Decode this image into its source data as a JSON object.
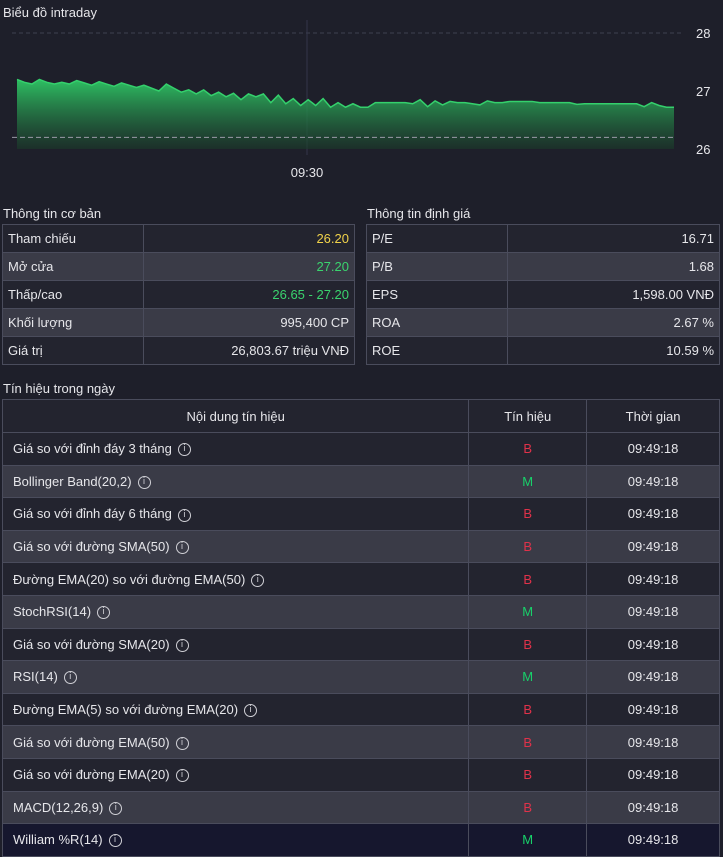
{
  "chart": {
    "title": "Biểu đồ intraday",
    "y_ticks": [
      "28",
      "27",
      "26"
    ],
    "x_tick": "09:30",
    "colors": {
      "line": "#34d06c",
      "reference_line": "#9a9aa6"
    }
  },
  "chart_data": {
    "type": "area",
    "title": "Biểu đồ intraday",
    "ylim": [
      26,
      28
    ],
    "reference": 26.2,
    "x_ticks": [
      "09:30"
    ],
    "values": [
      27.2,
      27.15,
      27.12,
      27.2,
      27.15,
      27.12,
      27.15,
      27.12,
      27.18,
      27.14,
      27.1,
      27.16,
      27.12,
      27.08,
      27.14,
      27.1,
      27.06,
      27.1,
      27.05,
      27.0,
      27.12,
      27.05,
      26.98,
      27.02,
      26.95,
      27.02,
      26.92,
      26.98,
      26.9,
      26.96,
      26.85,
      26.95,
      26.9,
      26.95,
      26.8,
      26.93,
      26.78,
      26.87,
      26.75,
      26.85,
      26.75,
      26.87,
      26.72,
      26.8,
      26.72,
      26.78,
      26.72,
      26.72,
      26.8,
      26.8,
      26.8,
      26.8,
      26.8,
      26.78,
      26.85,
      26.73,
      26.83,
      26.76,
      26.82,
      26.8,
      26.8,
      26.78,
      26.76,
      26.83,
      26.8,
      26.8,
      26.82,
      26.82,
      26.82,
      26.82,
      26.8,
      26.8,
      26.8,
      26.8,
      26.8,
      26.77,
      26.78,
      26.78,
      26.78,
      26.78,
      26.78,
      26.78,
      26.78,
      26.78,
      26.73,
      26.8,
      26.75,
      26.72,
      26.72
    ]
  },
  "basic_info": {
    "title": "Thông tin cơ bản",
    "rows": [
      {
        "label": "Tham chiếu",
        "value": "26.20",
        "color": "#f0d24a"
      },
      {
        "label": "Mở cửa",
        "value": "27.20",
        "color": "#3ad36e"
      },
      {
        "label": "Thấp/cao",
        "value": "26.65 - 27.20",
        "color": "#3ad36e"
      },
      {
        "label": "Khối lượng",
        "value": "995,400 CP",
        "color": "#e6e6ea"
      },
      {
        "label": "Giá trị",
        "value": "26,803.67 triệu VNĐ",
        "color": "#e6e6ea"
      }
    ]
  },
  "valuation": {
    "title": "Thông tin định giá",
    "rows": [
      {
        "label": "P/E",
        "value": "16.71"
      },
      {
        "label": "P/B",
        "value": "1.68"
      },
      {
        "label": "EPS",
        "value": "1,598.00 VNĐ"
      },
      {
        "label": "ROA",
        "value": "2.67 %"
      },
      {
        "label": "ROE",
        "value": "10.59 %"
      }
    ]
  },
  "signals": {
    "title": "Tín hiệu trong ngày",
    "headers": [
      "Nội dung tín hiệu",
      "Tín hiệu",
      "Thời gian"
    ],
    "info_icon": "info-icon",
    "colors": {
      "B": "#e0324a",
      "M": "#18d16a"
    },
    "rows": [
      {
        "name": "Giá so với đỉnh đáy 3 tháng",
        "signal": "B",
        "time": "09:49:18"
      },
      {
        "name": "Bollinger Band(20,2)",
        "signal": "M",
        "time": "09:49:18"
      },
      {
        "name": "Giá so với đỉnh đáy 6 tháng",
        "signal": "B",
        "time": "09:49:18"
      },
      {
        "name": "Giá so với đường SMA(50)",
        "signal": "B",
        "time": "09:49:18"
      },
      {
        "name": "Đường EMA(20) so với đường EMA(50)",
        "signal": "B",
        "time": "09:49:18"
      },
      {
        "name": "StochRSI(14)",
        "signal": "M",
        "time": "09:49:18"
      },
      {
        "name": "Giá so với đường SMA(20)",
        "signal": "B",
        "time": "09:49:18"
      },
      {
        "name": "RSI(14)",
        "signal": "M",
        "time": "09:49:18"
      },
      {
        "name": "Đường EMA(5) so với đường EMA(20)",
        "signal": "B",
        "time": "09:49:18"
      },
      {
        "name": "Giá so với đường EMA(50)",
        "signal": "B",
        "time": "09:49:18"
      },
      {
        "name": "Giá so với đường EMA(20)",
        "signal": "B",
        "time": "09:49:18"
      },
      {
        "name": "MACD(12,26,9)",
        "signal": "B",
        "time": "09:49:18"
      },
      {
        "name": "William %R(14)",
        "signal": "M",
        "time": "09:49:18"
      }
    ]
  }
}
